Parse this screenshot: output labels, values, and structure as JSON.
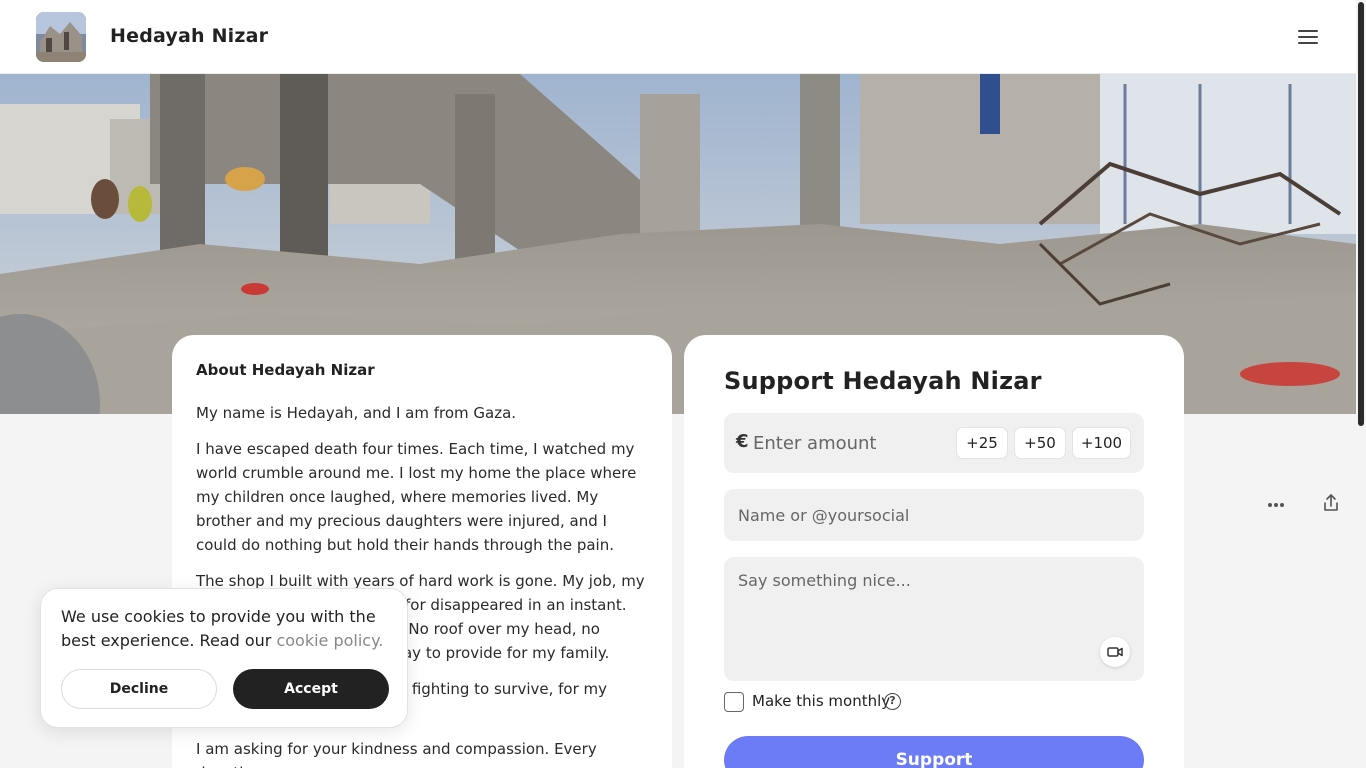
{
  "header": {
    "creator_name": "Hedayah Nizar",
    "avatar_icon": "avatar-image",
    "menu_icon": "hamburger-menu-icon"
  },
  "cover": {
    "image_icon": "cover-photo-ruins"
  },
  "about": {
    "title": "About Hedayah Nizar",
    "paragraphs": [
      "My name is Hedayah, and I am from Gaza.",
      "I have escaped death four times. Each time, I watched my world crumble around me. I lost my home the place where my children once laughed, where memories lived. My brother and my precious daughters were injured, and I could do nothing but hold their hands through the pain.",
      "The shop I built with years of hard work is gone. My job, my future, everything I worked for disappeared in an instant. Now, I am left with nothing. No roof over my head, no source of income, and no way to provide for my family.",
      "I am doing everything I can, fighting to survive, for my daughters, for my family.",
      "I am asking for your kindness and compassion. Every donation, no"
    ]
  },
  "support": {
    "title": "Support Hedayah Nizar",
    "currency_symbol": "€",
    "amount_placeholder": "Enter amount",
    "quick_amounts": [
      "+25",
      "+50",
      "+100"
    ],
    "name_placeholder": "Name or @yoursocial",
    "message_placeholder": "Say something nice...",
    "monthly_label": "Make this monthly",
    "monthly_checked": false,
    "help_glyph": "?",
    "submit_label": "Support",
    "accent_color": "#6b7cf6"
  },
  "cookie": {
    "text": "We use cookies to provide you with the best experience. Read our",
    "link_text": "cookie policy.",
    "decline_label": "Decline",
    "accept_label": "Accept"
  },
  "utility": {
    "more_icon": "more-dots-icon",
    "share_icon": "share-icon"
  }
}
